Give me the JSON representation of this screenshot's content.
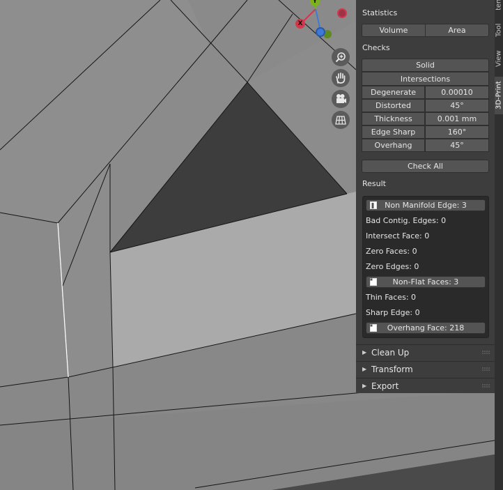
{
  "panel": {
    "statistics": {
      "title": "Statistics",
      "volume_label": "Volume",
      "area_label": "Area"
    },
    "checks": {
      "title": "Checks",
      "solid_label": "Solid",
      "intersections_label": "Intersections",
      "rows": [
        {
          "label": "Degenerate",
          "value": "0.00010"
        },
        {
          "label": "Distorted",
          "value": "45°"
        },
        {
          "label": "Thickness",
          "value": "0.001 mm"
        },
        {
          "label": "Edge Sharp",
          "value": "160°"
        },
        {
          "label": "Overhang",
          "value": "45°"
        }
      ],
      "check_all_label": "Check All"
    },
    "result": {
      "title": "Result",
      "non_manifold": "Non Manifold Edge: 3",
      "bad_contig": "Bad Contig. Edges: 0",
      "intersect_face": "Intersect Face: 0",
      "zero_faces": "Zero Faces: 0",
      "zero_edges": "Zero Edges: 0",
      "non_flat": "Non-Flat Faces: 3",
      "thin_faces": "Thin Faces: 0",
      "sharp_edge": "Sharp Edge: 0",
      "overhang_face": "Overhang Face: 218"
    },
    "subpanels": {
      "clean_up": "Clean Up",
      "transform": "Transform",
      "export": "Export"
    }
  },
  "tabs": {
    "item": "Item",
    "tool": "Tool",
    "view": "View",
    "print3d": "3D-Print"
  },
  "gizmo": {
    "x_label": "X",
    "y_label": "Y"
  },
  "colors": {
    "panel_bg": "#3d3d3d",
    "button_bg": "#545454",
    "result_bg": "#2a2a2a",
    "axis_x": "#d0394c",
    "axis_y": "#7db31a",
    "axis_z": "#3f7ad6"
  },
  "icons": {
    "zoom": "zoom-in-icon",
    "pan": "hand-icon",
    "camera": "camera-icon",
    "ortho": "grid-icon"
  }
}
